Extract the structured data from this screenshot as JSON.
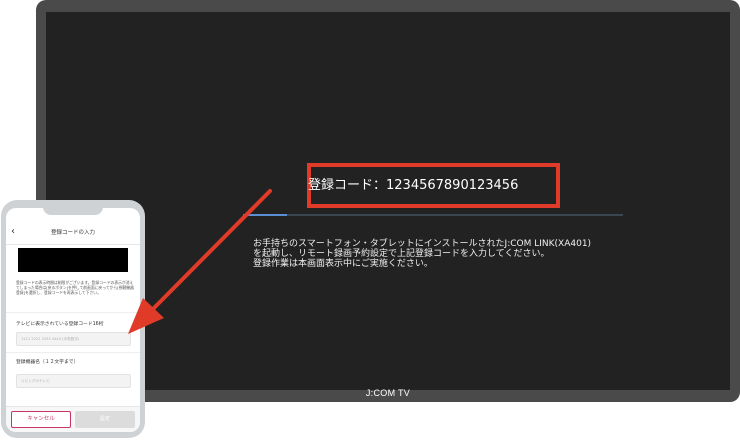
{
  "tv": {
    "brand": "J:COM TV",
    "registration_code": "登録コード：1234567890123456",
    "progress_fraction": 0.115,
    "instructions": [
      "お手持ちのスマートフォン・タブレットにインストールされたJ:COM LINK(XA401)",
      "を起動し、リモート録画予約設定で上記登録コードを入力してください。",
      "登録作業は本画面表示中にご実施ください。"
    ]
  },
  "phone": {
    "title": "登録コードの入力",
    "notes": "登録コードの表示時間は制限がございます。登録コードの表示が消えてしまった場合は[戻るボタン]を押して前画面に戻ってから[視聴機器登録]を選択し、登録コードを再表示して下さい。",
    "code_label": "テレビに表示されている登録コード16桁",
    "code_placeholder": "1111 2222 3333 4444 (半角数字)",
    "device_label": "登録機器名（１２文字まで）",
    "device_placeholder": "リビングのテレビ",
    "cancel_label": "キャンセル",
    "ok_label": "設定"
  },
  "colors": {
    "highlight": "#e03a28",
    "tv_background": "#222222",
    "cancel_accent": "#c8336a"
  },
  "icons": {
    "back": "chevron-left-icon",
    "arrow": "red-arrow-icon"
  }
}
